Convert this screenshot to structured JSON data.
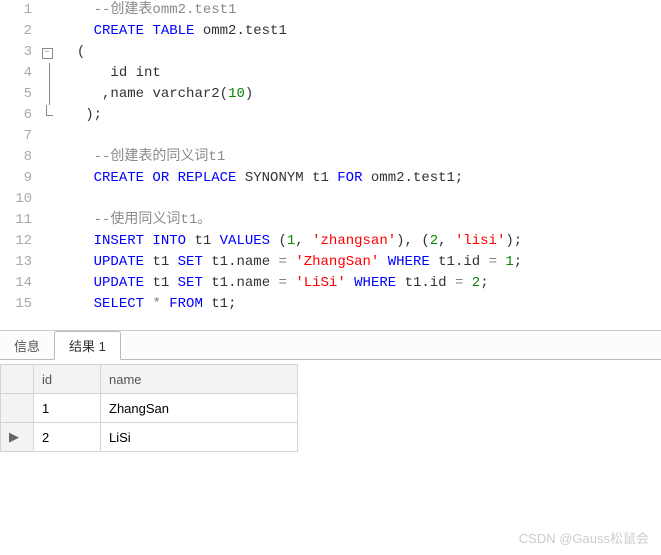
{
  "editor": {
    "lines": [
      {
        "n": 1,
        "fold": "",
        "tokens": [
          [
            "    ",
            "p"
          ],
          [
            "--创建表omm2.test1",
            "comment"
          ]
        ]
      },
      {
        "n": 2,
        "fold": "",
        "tokens": [
          [
            "    ",
            "p"
          ],
          [
            "CREATE TABLE",
            "keyword"
          ],
          [
            " ",
            "p"
          ],
          [
            "omm2.test1",
            "ident"
          ]
        ]
      },
      {
        "n": 3,
        "fold": "open",
        "tokens": [
          [
            "  ",
            "p"
          ],
          [
            "(",
            "punct"
          ]
        ]
      },
      {
        "n": 4,
        "fold": "bar",
        "tokens": [
          [
            "      ",
            "p"
          ],
          [
            "id int",
            "ident"
          ]
        ]
      },
      {
        "n": 5,
        "fold": "bar",
        "tokens": [
          [
            "     ,",
            "p"
          ],
          [
            "name",
            "ident"
          ],
          [
            " ",
            "p"
          ],
          [
            "varchar2",
            "ident"
          ],
          [
            "(",
            "punct"
          ],
          [
            "10",
            "number"
          ],
          [
            ")",
            "punct"
          ]
        ]
      },
      {
        "n": 6,
        "fold": "end",
        "tokens": [
          [
            "   ",
            "p"
          ],
          [
            ");",
            "punct"
          ]
        ]
      },
      {
        "n": 7,
        "fold": "",
        "tokens": []
      },
      {
        "n": 8,
        "fold": "",
        "tokens": [
          [
            "    ",
            "p"
          ],
          [
            "--创建表的同义词t1",
            "comment"
          ]
        ]
      },
      {
        "n": 9,
        "fold": "",
        "tokens": [
          [
            "    ",
            "p"
          ],
          [
            "CREATE OR REPLACE",
            "keyword"
          ],
          [
            " ",
            "p"
          ],
          [
            "SYNONYM",
            "ident"
          ],
          [
            " ",
            "p"
          ],
          [
            "t1",
            "ident"
          ],
          [
            " ",
            "p"
          ],
          [
            "FOR",
            "keyword"
          ],
          [
            " ",
            "p"
          ],
          [
            "omm2.test1;",
            "ident"
          ]
        ]
      },
      {
        "n": 10,
        "fold": "",
        "tokens": []
      },
      {
        "n": 11,
        "fold": "",
        "tokens": [
          [
            "    ",
            "p"
          ],
          [
            "--使用同义词t1。",
            "comment"
          ]
        ]
      },
      {
        "n": 12,
        "fold": "",
        "tokens": [
          [
            "    ",
            "p"
          ],
          [
            "INSERT INTO",
            "keyword"
          ],
          [
            " ",
            "p"
          ],
          [
            "t1",
            "ident"
          ],
          [
            " ",
            "p"
          ],
          [
            "VALUES",
            "keyword"
          ],
          [
            " (",
            "punct"
          ],
          [
            "1",
            "number"
          ],
          [
            ", ",
            "punct"
          ],
          [
            "'zhangsan'",
            "string"
          ],
          [
            "), (",
            "punct"
          ],
          [
            "2",
            "number"
          ],
          [
            ", ",
            "punct"
          ],
          [
            "'lisi'",
            "string"
          ],
          [
            ");",
            "punct"
          ]
        ]
      },
      {
        "n": 13,
        "fold": "",
        "tokens": [
          [
            "    ",
            "p"
          ],
          [
            "UPDATE",
            "keyword"
          ],
          [
            " ",
            "p"
          ],
          [
            "t1",
            "ident"
          ],
          [
            " ",
            "p"
          ],
          [
            "SET",
            "keyword"
          ],
          [
            " ",
            "p"
          ],
          [
            "t1.name",
            "ident"
          ],
          [
            " ",
            "p"
          ],
          [
            "=",
            "star"
          ],
          [
            " ",
            "p"
          ],
          [
            "'ZhangSan'",
            "string"
          ],
          [
            " ",
            "p"
          ],
          [
            "WHERE",
            "keyword"
          ],
          [
            " ",
            "p"
          ],
          [
            "t1.id",
            "ident"
          ],
          [
            " ",
            "p"
          ],
          [
            "=",
            "star"
          ],
          [
            " ",
            "p"
          ],
          [
            "1",
            "number"
          ],
          [
            ";",
            "punct"
          ]
        ]
      },
      {
        "n": 14,
        "fold": "",
        "tokens": [
          [
            "    ",
            "p"
          ],
          [
            "UPDATE",
            "keyword"
          ],
          [
            " ",
            "p"
          ],
          [
            "t1",
            "ident"
          ],
          [
            " ",
            "p"
          ],
          [
            "SET",
            "keyword"
          ],
          [
            " ",
            "p"
          ],
          [
            "t1.name",
            "ident"
          ],
          [
            " ",
            "p"
          ],
          [
            "=",
            "star"
          ],
          [
            " ",
            "p"
          ],
          [
            "'LiSi'",
            "string"
          ],
          [
            " ",
            "p"
          ],
          [
            "WHERE",
            "keyword"
          ],
          [
            " ",
            "p"
          ],
          [
            "t1.id",
            "ident"
          ],
          [
            " ",
            "p"
          ],
          [
            "=",
            "star"
          ],
          [
            " ",
            "p"
          ],
          [
            "2",
            "number"
          ],
          [
            ";",
            "punct"
          ]
        ]
      },
      {
        "n": 15,
        "fold": "",
        "tokens": [
          [
            "    ",
            "p"
          ],
          [
            "SELECT",
            "keyword"
          ],
          [
            " ",
            "p"
          ],
          [
            "*",
            "star"
          ],
          [
            " ",
            "p"
          ],
          [
            "FROM",
            "keyword"
          ],
          [
            " ",
            "p"
          ],
          [
            "t1;",
            "ident"
          ]
        ]
      }
    ]
  },
  "tabs": {
    "info": "信息",
    "result1": "结果 1"
  },
  "grid": {
    "headers": {
      "id": "id",
      "name": "name"
    },
    "rows": [
      {
        "marker": "",
        "id": "1",
        "name": "ZhangSan"
      },
      {
        "marker": "▶",
        "id": "2",
        "name": "LiSi"
      }
    ]
  },
  "watermark": "CSDN @Gauss松鼠会"
}
